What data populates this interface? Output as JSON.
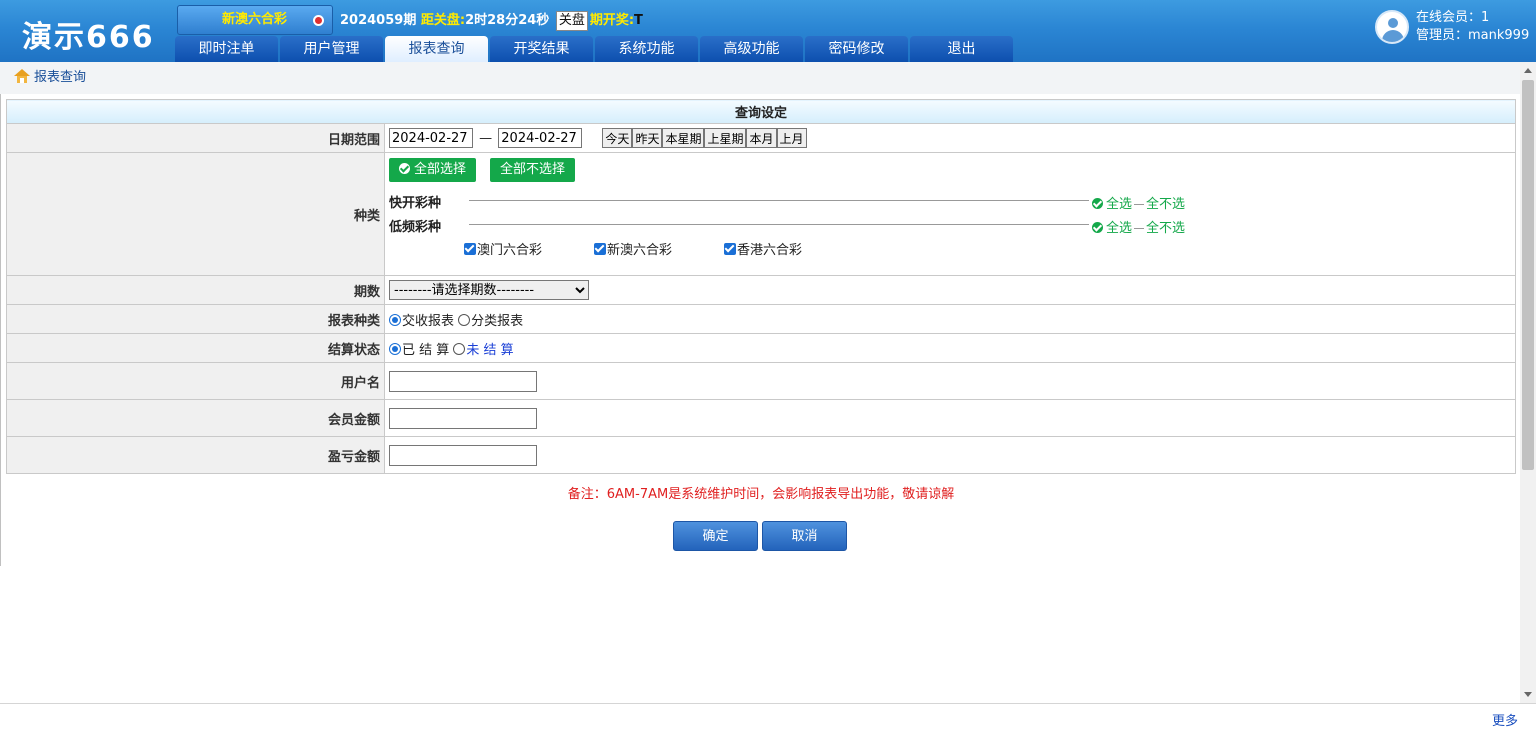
{
  "app": {
    "logo": "演示666"
  },
  "header": {
    "lottery_selected": "新澳六合彩",
    "issue_number": "2024059期",
    "close_label": "距关盘:",
    "close_countdown": "2时28分24秒",
    "closed_badge": "关盘",
    "draw_label": "期开奖:",
    "draw_value": "T",
    "online_members": "在线会员：1",
    "admin": "管理员：mank999"
  },
  "nav": {
    "items": [
      {
        "label": "即时注单"
      },
      {
        "label": "用户管理"
      },
      {
        "label": "报表查询",
        "active": true
      },
      {
        "label": "开奖结果"
      },
      {
        "label": "系统功能"
      },
      {
        "label": "高级功能"
      },
      {
        "label": "密码修改"
      },
      {
        "label": "退出"
      }
    ]
  },
  "breadcrumb": {
    "label": "报表查询",
    "icon": "home-icon"
  },
  "form": {
    "title": "查询设定",
    "date_range": {
      "label": "日期范围",
      "start": "2024-02-27",
      "dash": "—",
      "end": "2024-02-27",
      "quick": [
        "今天",
        "昨天",
        "本星期",
        "上星期",
        "本月",
        "上月"
      ]
    },
    "category": {
      "label": "种类",
      "select_all": "全部选择",
      "select_none": "全部不选择",
      "groups": [
        {
          "name": "快开彩种",
          "all": "全选",
          "none": "全不选"
        },
        {
          "name": "低频彩种",
          "all": "全选",
          "none": "全不选"
        }
      ],
      "lotteries": [
        "澳门六合彩",
        "新澳六合彩",
        "香港六合彩"
      ]
    },
    "period": {
      "label": "期数",
      "placeholder": "--------请选择期数--------"
    },
    "report_type": {
      "label": "报表种类",
      "options": [
        "交收报表",
        "分类报表"
      ]
    },
    "settle_status": {
      "label": "结算状态",
      "options": [
        "已 结 算",
        "未 结 算"
      ]
    },
    "username": {
      "label": "用户名",
      "value": ""
    },
    "member_amount": {
      "label": "会员金额",
      "value": ""
    },
    "profit_amount": {
      "label": "盈亏金额",
      "value": ""
    }
  },
  "note": "备注：6AM-7AM是系统维护时间，会影响报表导出功能，敬请谅解",
  "buttons": {
    "confirm": "确定",
    "cancel": "取消"
  },
  "footer": {
    "more": "更多"
  },
  "colors": {
    "header_blue": "#2b86d4",
    "accent_green": "#14a84a",
    "note_red": "#e02020",
    "highlight_yellow": "#ffea00"
  }
}
